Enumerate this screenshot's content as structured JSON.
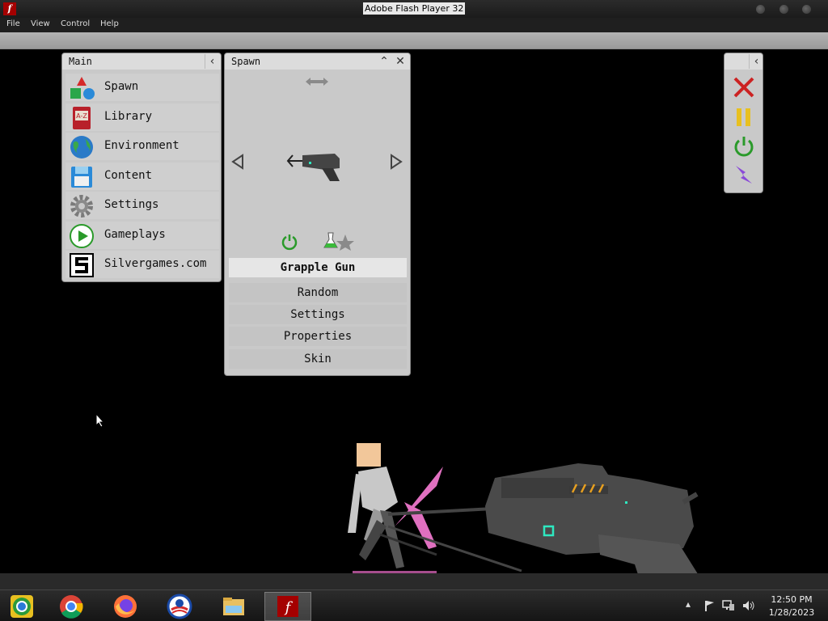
{
  "window": {
    "title": "Adobe Flash Player 32",
    "menu": [
      "File",
      "View",
      "Control",
      "Help"
    ]
  },
  "main_panel": {
    "title": "Main",
    "items": [
      {
        "label": "Spawn",
        "icon": "shapes-icon"
      },
      {
        "label": "Library",
        "icon": "book-icon"
      },
      {
        "label": "Environment",
        "icon": "globe-icon"
      },
      {
        "label": "Content",
        "icon": "floppy-disk-icon"
      },
      {
        "label": "Settings",
        "icon": "gear-icon"
      },
      {
        "label": "Gameplays",
        "icon": "play-icon"
      },
      {
        "label": "Silvergames.com",
        "icon": "silvergames-logo-icon"
      }
    ]
  },
  "spawn_panel": {
    "title": "Spawn",
    "selected_item": "Grapple Gun",
    "buttons": [
      "Random",
      "Settings",
      "Properties",
      "Skin"
    ]
  },
  "taskbar": {
    "apps": [
      "chrome-alt-icon",
      "chrome-icon",
      "firefox-icon",
      "obama-logo-icon",
      "file-explorer-icon",
      "flash-player-icon"
    ],
    "time": "12:50 PM",
    "date": "1/28/2023"
  },
  "colors": {
    "panel_bg": "#c9c9c9",
    "close_red": "#cc2222",
    "pause_yellow": "#e8c020",
    "power_green": "#2a9a2a",
    "lightning_purple": "#8a4ad8"
  }
}
